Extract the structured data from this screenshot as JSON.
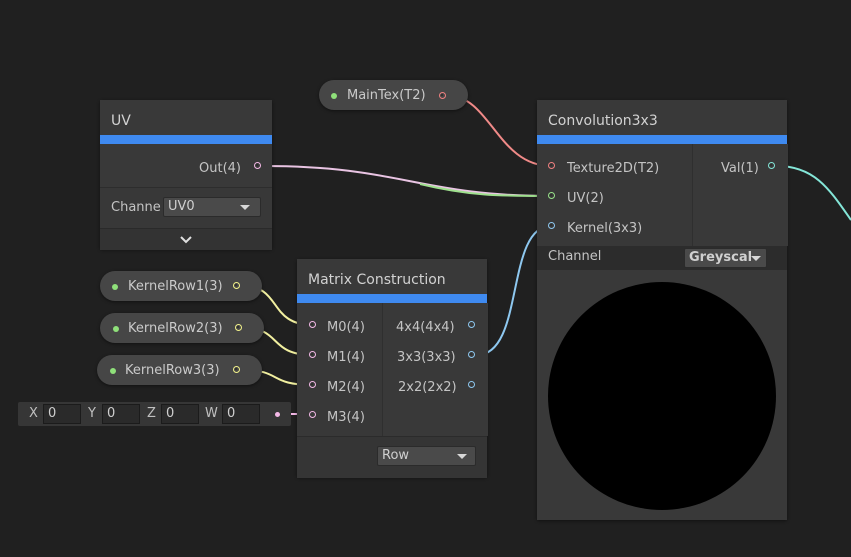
{
  "uv_node": {
    "title": "UV",
    "output": "Out(4)",
    "channel_label": "Channe",
    "channel_value": "UV0"
  },
  "maintex_property": {
    "label": "MainTex(T2)"
  },
  "kernel_rows": [
    {
      "label": "KernelRow1(3)"
    },
    {
      "label": "KernelRow2(3)"
    },
    {
      "label": "KernelRow3(3)"
    }
  ],
  "vector_input": {
    "x_label": "X",
    "x_value": "0",
    "y_label": "Y",
    "y_value": "0",
    "z_label": "Z",
    "z_value": "0",
    "w_label": "W",
    "w_value": "0"
  },
  "matrix_node": {
    "title": "Matrix Construction",
    "inputs": [
      "M0(4)",
      "M1(4)",
      "M2(4)",
      "M3(4)"
    ],
    "outputs": [
      "4x4(4x4)",
      "3x3(3x3)",
      "2x2(2x2)"
    ],
    "mode_value": "Row"
  },
  "conv_node": {
    "title": "Convolution3x3",
    "inputs": [
      "Texture2D(T2)",
      "UV(2)",
      "Kernel(3x3)"
    ],
    "output": "Val(1)",
    "channel_label": "Channel",
    "channel_value": "Greyscal"
  },
  "colors": {
    "accent": "#3f8af0",
    "texture_port": "#f08080",
    "vector2_port": "#98e28a",
    "vector3_port": "#f2f28a",
    "vector4_port": "#f3b8e6",
    "matrix_port": "#8ec8f0",
    "float_port": "#84e6d8"
  }
}
